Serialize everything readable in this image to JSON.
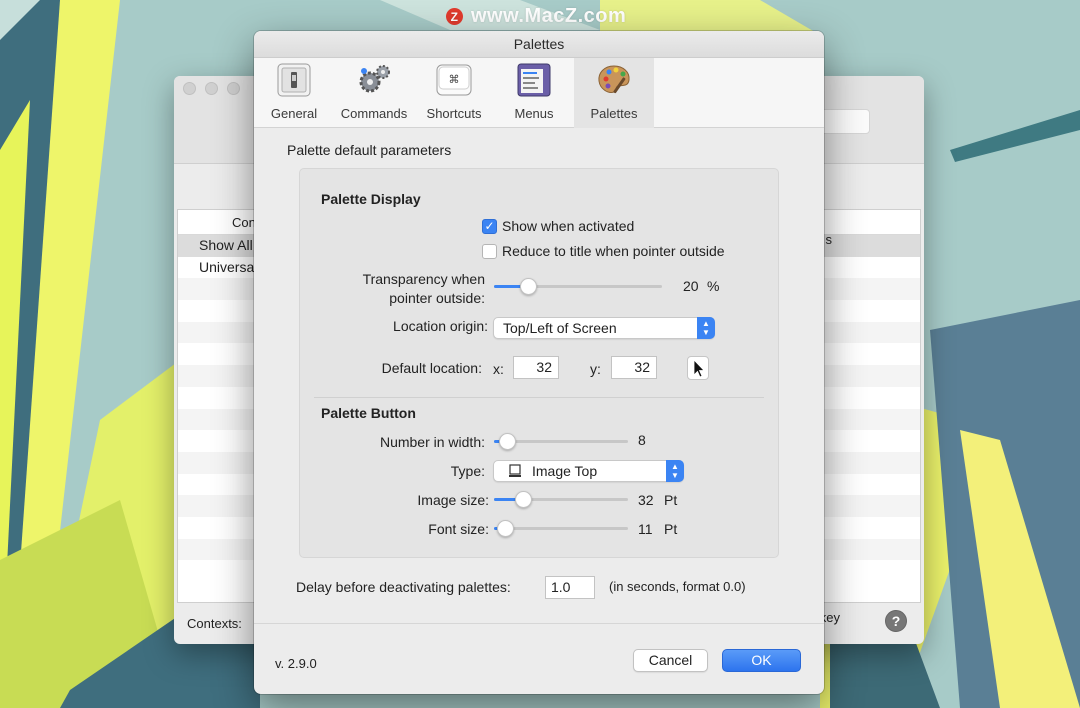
{
  "watermark": {
    "logo_letter": "Z",
    "text": "www.MacZ.com"
  },
  "background_window": {
    "list_header": "Con",
    "list_header_right": "s",
    "rows": [
      "Show All",
      "Universa"
    ],
    "footer_label": "Contexts:",
    "footer_right": "key",
    "help_label": "?"
  },
  "dialog": {
    "title": "Palettes",
    "tabs": [
      {
        "label": "General"
      },
      {
        "label": "Commands"
      },
      {
        "label": "Shortcuts"
      },
      {
        "label": "Menus"
      },
      {
        "label": "Palettes",
        "active": true
      }
    ],
    "section_title": "Palette default parameters",
    "palette_display": {
      "heading": "Palette Display",
      "show_when_activated": {
        "label": "Show when activated",
        "checked": true
      },
      "reduce_to_title": {
        "label": "Reduce to title when pointer outside",
        "checked": false
      },
      "transparency": {
        "label_line1": "Transparency when",
        "label_line2": "pointer outside:",
        "value": "20",
        "unit": "%",
        "fraction": 0.2
      },
      "location_origin": {
        "label": "Location origin:",
        "value": "Top/Left of Screen"
      },
      "default_location": {
        "label": "Default location:",
        "x_label": "x:",
        "x_value": "32",
        "y_label": "y:",
        "y_value": "32"
      }
    },
    "palette_button": {
      "heading": "Palette Button",
      "number_in_width": {
        "label": "Number in width:",
        "value": "8",
        "fraction": 0.1
      },
      "type": {
        "label": "Type:",
        "value": "Image Top"
      },
      "image_size": {
        "label": "Image size:",
        "value": "32",
        "unit": "Pt",
        "fraction": 0.22
      },
      "font_size": {
        "label": "Font size:",
        "value": "11",
        "unit": "Pt",
        "fraction": 0.08
      }
    },
    "delay": {
      "label": "Delay before deactivating palettes:",
      "value": "1.0",
      "hint": "(in seconds, format 0.0)"
    },
    "version": "v. 2.9.0",
    "cancel_label": "Cancel",
    "ok_label": "OK"
  },
  "colors": {
    "accent": "#3b84f3",
    "wallpaper": "#9fc6c4"
  }
}
